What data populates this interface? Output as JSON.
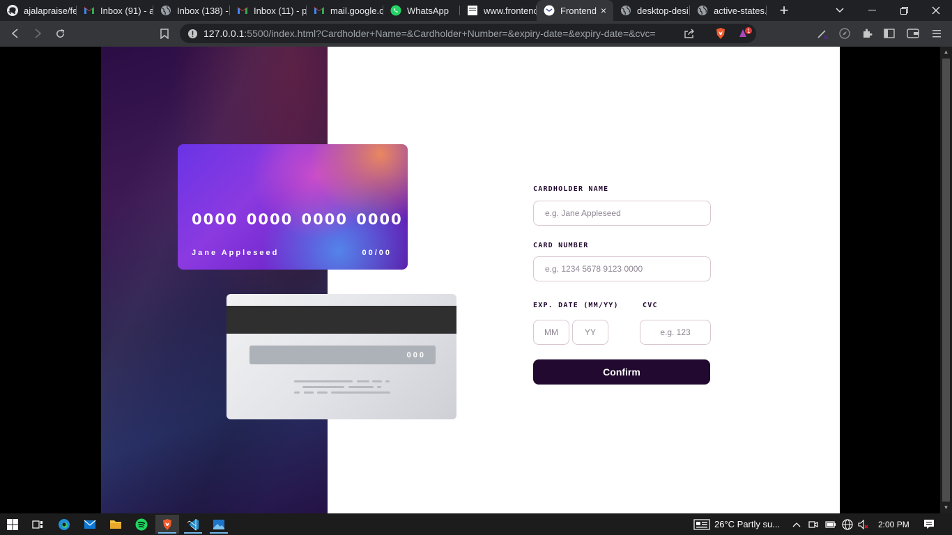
{
  "browser": {
    "tabs": [
      {
        "title": "ajalapraise/fe",
        "icon": "github-icon"
      },
      {
        "title": "Inbox (91) - a",
        "icon": "gmail-icon"
      },
      {
        "title": "Inbox (138) -",
        "icon": "globe-icon"
      },
      {
        "title": "Inbox (11) - p",
        "icon": "gmail-icon"
      },
      {
        "title": "mail.google.c",
        "icon": "gmail-icon"
      },
      {
        "title": "WhatsApp",
        "icon": "whatsapp-icon"
      },
      {
        "title": "www.frontenc",
        "icon": "page-icon"
      },
      {
        "title": "Frontend",
        "icon": "frontend-icon",
        "active": true,
        "close": "×"
      },
      {
        "title": "desktop-desi",
        "icon": "globe-icon"
      },
      {
        "title": "active-states.",
        "icon": "globe-icon"
      }
    ],
    "new_tab": "+",
    "url_host": "127.0.0.1",
    "url_rest": ":5500/index.html?Cardholder+Name=&Cardholder+Number=&expiry-date=&expiry-date=&cvc=",
    "brave_badge": "1"
  },
  "card": {
    "number": "0000 0000 0000 0000",
    "name": "Jane Appleseed",
    "expiry": "00/00",
    "cvc": "000"
  },
  "form": {
    "name_label": "CARDHOLDER  NAME",
    "name_placeholder": "e.g. Jane Appleseed",
    "number_label": "CARD  NUMBER",
    "number_placeholder": "e.g. 1234 5678 9123 0000",
    "exp_label": "EXP. DATE (MM/YY)",
    "cvc_label": "CVC",
    "mm_placeholder": "MM",
    "yy_placeholder": "YY",
    "cvc_placeholder": "e.g. 123",
    "confirm_label": "Confirm"
  },
  "taskbar": {
    "weather": "26°C  Partly su...",
    "time": "2:00 PM"
  }
}
